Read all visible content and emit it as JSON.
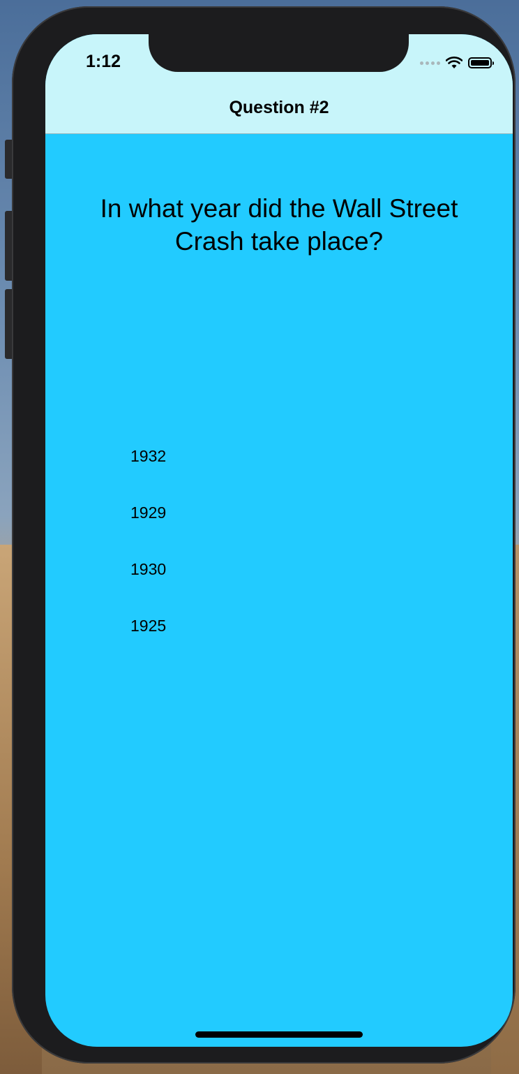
{
  "status_bar": {
    "time": "1:12",
    "icons": [
      "cellular-dots-icon",
      "wifi-icon",
      "battery-icon"
    ]
  },
  "nav": {
    "title": "Question #2"
  },
  "quiz": {
    "question": "In what year did the Wall Street Crash take place?",
    "answers": [
      "1932",
      "1929",
      "1930",
      "1925"
    ]
  },
  "colors": {
    "background": "#22cbff",
    "navbar": "#c8f5fa",
    "text": "#000000"
  }
}
